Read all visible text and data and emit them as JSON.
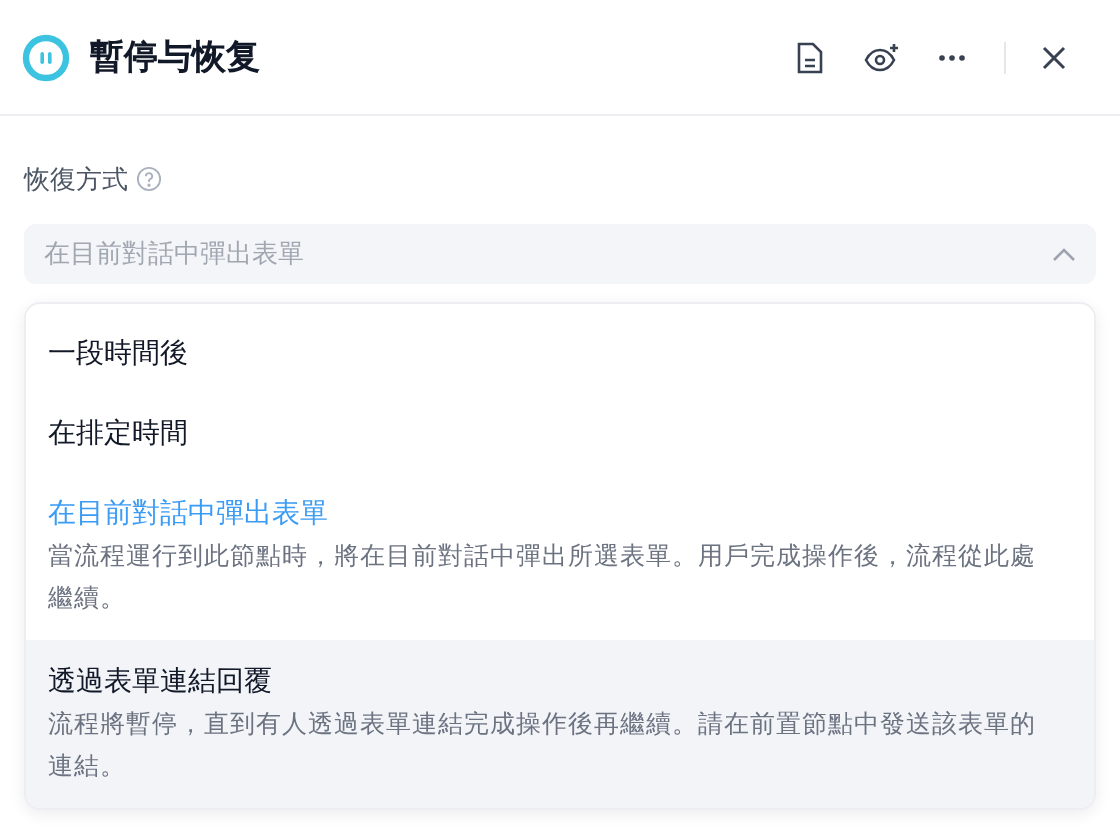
{
  "header": {
    "title": "暫停与恢复"
  },
  "field": {
    "label": "恢復方式",
    "placeholder": "在目前對話中彈出表單",
    "expanded": true
  },
  "options": [
    {
      "title": "一段時間後",
      "selected": false,
      "highlighted": false
    },
    {
      "title": "在排定時間",
      "selected": false,
      "highlighted": false
    },
    {
      "title": "在目前對話中彈出表單",
      "description": "當流程運行到此節點時，將在目前對話中彈出所選表單。用戶完成操作後，流程從此處繼續。",
      "selected": true,
      "highlighted": false
    },
    {
      "title": "透過表單連結回覆",
      "description": "流程將暫停，直到有人透過表單連結完成操作後再繼續。請在前置節點中發送該表單的連結。",
      "selected": false,
      "highlighted": true
    }
  ]
}
